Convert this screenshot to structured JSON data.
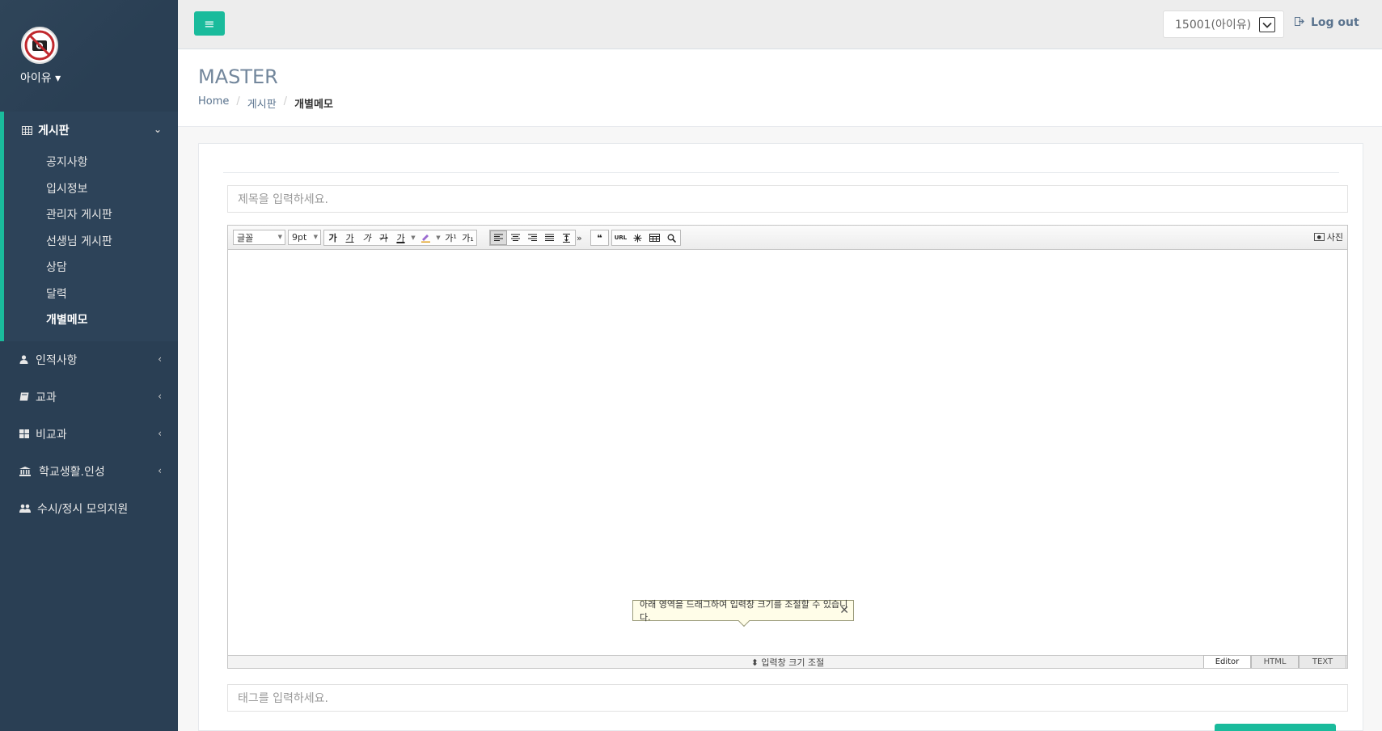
{
  "profile": {
    "name": "아이유 ▾",
    "avatar_icon": "no-camera-icon"
  },
  "sidebar": {
    "groups": [
      {
        "label": "게시판",
        "icon": "table-icon",
        "expanded": true,
        "items": [
          "공지사항",
          "입시정보",
          "관리자 게시판",
          "선생님 게시판",
          "상담",
          "달력",
          "개별메모"
        ]
      },
      {
        "label": "인적사항",
        "icon": "user-icon"
      },
      {
        "label": "교과",
        "icon": "book-icon"
      },
      {
        "label": "비교과",
        "icon": "grid-icon"
      },
      {
        "label": "학교생활.인성",
        "icon": "bank-icon"
      },
      {
        "label": "수시/정시 모의지원",
        "icon": "users-icon"
      }
    ]
  },
  "topnav": {
    "user_select": "15001(아이유)",
    "logout": "Log out"
  },
  "page": {
    "title": "MASTER",
    "breadcrumb": [
      "Home",
      "게시판",
      "개별메모"
    ]
  },
  "form": {
    "title_placeholder": "제목을 입력하세요.",
    "tag_placeholder": "태그를 입력하세요."
  },
  "editor": {
    "font_select": "글꼴",
    "size_select": "9pt",
    "format_buttons": [
      "가",
      "가",
      "가",
      "가",
      "가"
    ],
    "sup_label": "가¹",
    "sub_label": "가₁",
    "more_label": "»",
    "quote_label": "❝",
    "url_label": "URL",
    "photo_label": "사진",
    "notice": "아래 영역을 드래그하여 입력창 크기를 조절할 수 있습니다.",
    "notice_close": "✕",
    "resize_label": "⬍ 입력창 크기 조절",
    "modes": [
      "Editor",
      "HTML",
      "TEXT"
    ]
  },
  "colors": {
    "sidebar": "#2a3f54",
    "accent": "#1abb9c"
  }
}
